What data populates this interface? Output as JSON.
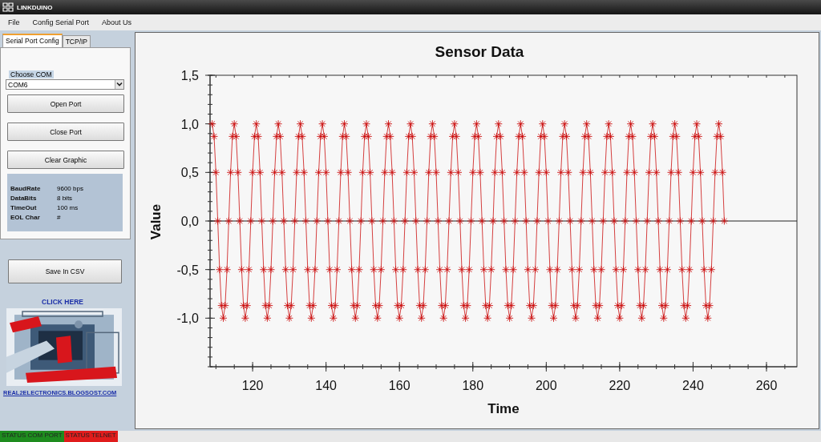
{
  "window": {
    "title": "LINKDUINO"
  },
  "menu": [
    "File",
    "Config Serial Port",
    "About Us"
  ],
  "tabs": [
    {
      "label": "Serial Port Config",
      "selected": true
    },
    {
      "label": "TCP/IP",
      "selected": false
    }
  ],
  "com_select": {
    "label": "Choose COM",
    "value": "COM6"
  },
  "buttons": [
    "Open Port",
    "Close Port",
    "Clear Graphic"
  ],
  "port_info": [
    {
      "label": "BaudRate",
      "value": "9600 bps"
    },
    {
      "label": "DataBits",
      "value": "8 bits"
    },
    {
      "label": "TimeOut",
      "value": "100 ms"
    },
    {
      "label": "EOL Char",
      "value": "#"
    }
  ],
  "save_button": "Save In CSV",
  "click_here": "CLICK HERE",
  "logo": {
    "kind": "picture"
  },
  "link": "REAL2ELECTRONICS.BLOGSOST.COM",
  "status_bar": [
    {
      "label": "STATUS COM PORT",
      "color": "#1e8c1e"
    },
    {
      "label": "STATUS TELNET",
      "color": "#e01c1c"
    }
  ],
  "chart": {
    "chart_data": {
      "type": "line",
      "title": "Sensor Data",
      "xlabel": "Time",
      "ylabel": "Value",
      "xlim": [
        108.4,
        268.3
      ],
      "ylim": [
        -1.5,
        1.5
      ],
      "xticks": [
        120,
        140,
        160,
        180,
        200,
        220,
        240,
        260
      ],
      "yticks": [
        {
          "value": 1.5,
          "label": "1,5"
        },
        {
          "value": 1,
          "label": "1,0"
        },
        {
          "value": 0.5,
          "label": "0,5"
        },
        {
          "value": 0,
          "label": "0,0"
        },
        {
          "value": -0.5,
          "label": "-0,5"
        },
        {
          "value": -1,
          "label": "-1,0"
        }
      ],
      "x": [
        109,
        109.5,
        110,
        110.5,
        111,
        111.5,
        112,
        112.5,
        113,
        113.5,
        114,
        114.5,
        115,
        115.5,
        116,
        116.5,
        117,
        117.5,
        118,
        118.5,
        119,
        119.5,
        120,
        120.5,
        121,
        121.5,
        122,
        122.5,
        123,
        123.5,
        124,
        124.5,
        125,
        125.5,
        126,
        126.5,
        127,
        127.5,
        128,
        128.5,
        129,
        129.5,
        130,
        130.5,
        131,
        131.5,
        132,
        132.5,
        133,
        133.5,
        134,
        134.5,
        135,
        135.5,
        136,
        136.5,
        137,
        137.5,
        138,
        138.5,
        139,
        139.5,
        140,
        140.5,
        141,
        141.5,
        142,
        142.5,
        143,
        143.5,
        144,
        144.5,
        145,
        145.5,
        146,
        146.5,
        147,
        147.5,
        148,
        148.5,
        149,
        149.5,
        150,
        150.5,
        151,
        151.5,
        152,
        152.5,
        153,
        153.5,
        154,
        154.5,
        155,
        155.5,
        156,
        156.5,
        157,
        157.5,
        158,
        158.5,
        159,
        159.5,
        160,
        160.5,
        161,
        161.5,
        162,
        162.5,
        163,
        163.5,
        164,
        164.5,
        165,
        165.5,
        166,
        166.5,
        167,
        167.5,
        168,
        168.5,
        169,
        169.5,
        170,
        170.5,
        171,
        171.5,
        172,
        172.5,
        173,
        173.5,
        174,
        174.5,
        175,
        175.5,
        176,
        176.5,
        177,
        177.5,
        178,
        178.5,
        179,
        179.5,
        180,
        180.5,
        181,
        181.5,
        182,
        182.5,
        183,
        183.5,
        184,
        184.5,
        185,
        185.5,
        186,
        186.5,
        187,
        187.5,
        188,
        188.5,
        189,
        189.5,
        190,
        190.5,
        191,
        191.5,
        192,
        192.5,
        193,
        193.5,
        194,
        194.5,
        195,
        195.5,
        196,
        196.5,
        197,
        197.5,
        198,
        198.5,
        199,
        199.5,
        200,
        200.5,
        201,
        201.5,
        202,
        202.5,
        203,
        203.5,
        204,
        204.5,
        205,
        205.5,
        206,
        206.5,
        207,
        207.5,
        208,
        208.5,
        209,
        209.5,
        210,
        210.5,
        211,
        211.5,
        212,
        212.5,
        213,
        213.5,
        214,
        214.5,
        215,
        215.5,
        216,
        216.5,
        217,
        217.5,
        218,
        218.5,
        219,
        219.5,
        220,
        220.5,
        221,
        221.5,
        222,
        222.5,
        223,
        223.5,
        224,
        224.5,
        225,
        225.5,
        226,
        226.5,
        227,
        227.5,
        228,
        228.5,
        229,
        229.5,
        230,
        230.5,
        231,
        231.5,
        232,
        232.5,
        233,
        233.5,
        234,
        234.5,
        235,
        235.5,
        236,
        236.5,
        237,
        237.5,
        238,
        238.5,
        239,
        239.5,
        240,
        240.5,
        241,
        241.5,
        242,
        242.5,
        243,
        243.5,
        244,
        244.5,
        245,
        245.5,
        246,
        246.5,
        247,
        247.5,
        248,
        248.5
      ],
      "series": [
        {
          "color": "#cc1010",
          "marker": "cross",
          "values": [
            1,
            0.87,
            0.5,
            0,
            -0.5,
            -0.87,
            -1,
            -0.87,
            -0.5,
            0,
            0.5,
            0.87,
            1,
            0.87,
            0.5,
            0,
            -0.5,
            -0.87,
            -1,
            -0.87,
            -0.5,
            0,
            0.5,
            0.87,
            1,
            0.87,
            0.5,
            0,
            -0.5,
            -0.87,
            -1,
            -0.87,
            -0.5,
            0,
            0.5,
            0.87,
            1,
            0.87,
            0.5,
            0,
            -0.5,
            -0.87,
            -1,
            -0.87,
            -0.5,
            0,
            0.5,
            0.87,
            1,
            0.87,
            0.5,
            0,
            -0.5,
            -0.87,
            -1,
            -0.87,
            -0.5,
            0,
            0.5,
            0.87,
            1,
            0.87,
            0.5,
            0,
            -0.5,
            -0.87,
            -1,
            -0.87,
            -0.5,
            0,
            0.5,
            0.87,
            1,
            0.87,
            0.5,
            0,
            -0.5,
            -0.87,
            -1,
            -0.87,
            -0.5,
            0,
            0.5,
            0.87,
            1,
            0.87,
            0.5,
            0,
            -0.5,
            -0.87,
            -1,
            -0.87,
            -0.5,
            0,
            0.5,
            0.87,
            1,
            0.87,
            0.5,
            0,
            -0.5,
            -0.87,
            -1,
            -0.87,
            -0.5,
            0,
            0.5,
            0.87,
            1,
            0.87,
            0.5,
            0,
            -0.5,
            -0.87,
            -1,
            -0.87,
            -0.5,
            0,
            0.5,
            0.87,
            1,
            0.87,
            0.5,
            0,
            -0.5,
            -0.87,
            -1,
            -0.87,
            -0.5,
            0,
            0.5,
            0.87,
            1,
            0.87,
            0.5,
            0,
            -0.5,
            -0.87,
            -1,
            -0.87,
            -0.5,
            0,
            0.5,
            0.87,
            1,
            0.87,
            0.5,
            0,
            -0.5,
            -0.87,
            -1,
            -0.87,
            -0.5,
            0,
            0.5,
            0.87,
            1,
            0.87,
            0.5,
            0,
            -0.5,
            -0.87,
            -1,
            -0.87,
            -0.5,
            0,
            0.5,
            0.87,
            1,
            0.87,
            0.5,
            0,
            -0.5,
            -0.87,
            -1,
            -0.87,
            -0.5,
            0,
            0.5,
            0.87,
            1,
            0.87,
            0.5,
            0,
            -0.5,
            -0.87,
            -1,
            -0.87,
            -0.5,
            0,
            0.5,
            0.87,
            1,
            0.87,
            0.5,
            0,
            -0.5,
            -0.87,
            -1,
            -0.87,
            -0.5,
            0,
            0.5,
            0.87,
            1,
            0.87,
            0.5,
            0,
            -0.5,
            -0.87,
            -1,
            -0.87,
            -0.5,
            0,
            0.5,
            0.87,
            1,
            0.87,
            0.5,
            0,
            -0.5,
            -0.87,
            -1,
            -0.87,
            -0.5,
            0,
            0.5,
            0.87,
            1,
            0.87,
            0.5,
            0,
            -0.5,
            -0.87,
            -1,
            -0.87,
            -0.5,
            0,
            0.5,
            0.87,
            1,
            0.87,
            0.5,
            0,
            -0.5,
            -0.87,
            -1,
            -0.87,
            -0.5,
            0,
            0.5,
            0.87,
            1,
            0.87,
            0.5,
            0,
            -0.5,
            -0.87,
            -1,
            -0.87,
            -0.5,
            0,
            0.5,
            0.87,
            1,
            0.87,
            0.5,
            0,
            -0.5,
            -0.87,
            -1,
            -0.87,
            -0.5,
            0,
            0.5,
            0.87,
            1,
            0.87,
            0.5,
            0
          ]
        }
      ]
    }
  }
}
